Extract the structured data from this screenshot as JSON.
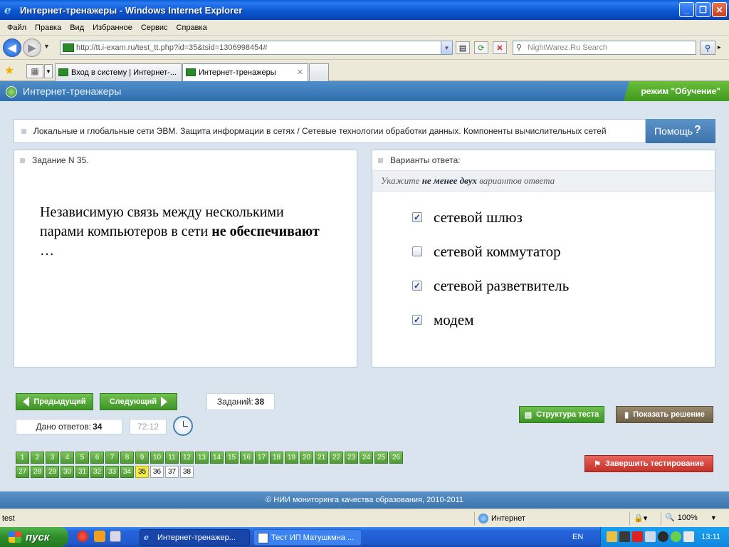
{
  "window": {
    "title": "Интернет-тренажеры - Windows Internet Explorer",
    "min_label": "_",
    "max_label": "❐",
    "close_label": "✕"
  },
  "menu": [
    "Файл",
    "Правка",
    "Вид",
    "Избранное",
    "Сервис",
    "Справка"
  ],
  "address": {
    "url": "http://tt.i-exam.ru/test_tt.php?id=35&tsid=1306998454#",
    "search_placeholder": "NightWarez.Ru Search"
  },
  "tabs": [
    {
      "label": "Вход в систему | Интернет-..."
    },
    {
      "label": "Интернет-тренажеры"
    }
  ],
  "page": {
    "site_title": "Интернет-тренажеры",
    "mode": "режим \"Обучение\"",
    "topic": "Локальные и глобальные сети ЭВМ. Защита информации в сетях / Сетевые технологии обработки данных. Компоненты вычислительных сетей",
    "help_label": "Помощь",
    "help_icon": "?",
    "task_title": "Задание N 35.",
    "question_plain": "Независимую связь между несколькими парами компьютеров в сети ",
    "question_bold": "не обеспечивают",
    "question_tail": " …",
    "answers_title": "Варианты ответа:",
    "hint_pre": "Укажите ",
    "hint_bold": "не менее двух",
    "hint_post": " вариантов ответа",
    "answers": [
      {
        "text": "сетевой шлюз",
        "checked": true
      },
      {
        "text": "сетевой коммутатор",
        "checked": false
      },
      {
        "text": "сетевой разветвитель",
        "checked": true
      },
      {
        "text": "модем",
        "checked": true
      }
    ],
    "prev_label": "Предыдущий",
    "next_label": "Следующий",
    "tasks_label": "Заданий:",
    "tasks_count": "38",
    "answered_label": "Дано ответов:",
    "answered_count": "34",
    "timer": "72:12",
    "structure_label": "Структура теста",
    "solution_label": "Показать решение",
    "finish_label": "Завершить тестирование",
    "numbers_row1": [
      "1",
      "2",
      "3",
      "4",
      "5",
      "6",
      "7",
      "8",
      "9",
      "10",
      "11",
      "12",
      "13",
      "14",
      "15",
      "16",
      "17",
      "18",
      "19",
      "20",
      "21",
      "22",
      "23",
      "24",
      "25",
      "26"
    ],
    "numbers_row2": [
      "27",
      "28",
      "29",
      "30",
      "31",
      "32",
      "33",
      "34",
      "35",
      "36",
      "37",
      "38"
    ],
    "current_task": "35",
    "footer": "© НИИ мониторинга качества образования, 2010-2011"
  },
  "status": {
    "text": "test",
    "zone": "Интернет",
    "zoom": "100%"
  },
  "taskbar": {
    "start": "пуск",
    "tasks": [
      {
        "label": "Интернет-тренажер..."
      },
      {
        "label": "Тест ИП Матушкмна ..."
      }
    ],
    "lang": "EN",
    "time": "13:11"
  },
  "colors": {
    "green_button": "#4e9a32",
    "current_number": "#f3e948",
    "header_blue": "#3c74ad",
    "finish_red": "#c2322a"
  }
}
